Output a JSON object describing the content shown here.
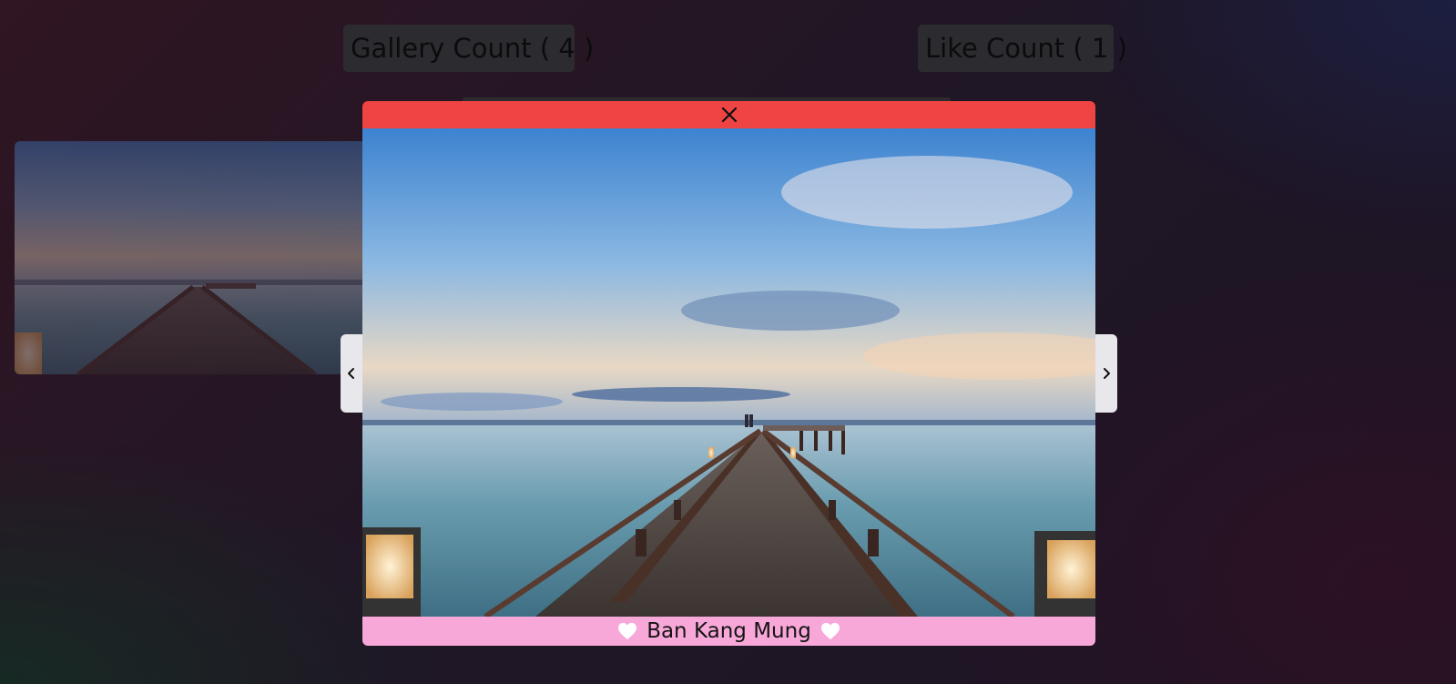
{
  "counters": {
    "gallery": "Gallery Count ( 4 )",
    "likes": "Like Count ( 1 )"
  },
  "lightbox": {
    "caption": "Ban Kang Mung",
    "close_icon": "close-icon",
    "prev_icon": "chevron-left-icon",
    "next_icon": "chevron-right-icon",
    "like_icon": "heart-icon"
  },
  "colors": {
    "header": "#ef4444",
    "footer": "#f7a8d8",
    "nav": "#e8e8ec"
  }
}
